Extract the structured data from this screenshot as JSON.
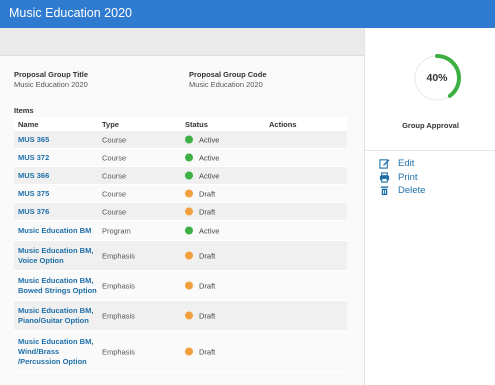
{
  "app": {
    "title": "Music Education 2020"
  },
  "proposal": {
    "group_title_label": "Proposal Group Title",
    "group_title_value": "Music Education 2020",
    "group_code_label": "Proposal Group Code",
    "group_code_value": "Music Education 2020"
  },
  "items": {
    "label": "Items",
    "columns": [
      "Name",
      "Type",
      "Status",
      "Actions"
    ],
    "rows": [
      {
        "name": "MUS 365",
        "type": "Course",
        "status": "Active"
      },
      {
        "name": "MUS 372",
        "type": "Course",
        "status": "Active"
      },
      {
        "name": "MUS 366",
        "type": "Course",
        "status": "Active"
      },
      {
        "name": "MUS 375",
        "type": "Course",
        "status": "Draft"
      },
      {
        "name": "MUS 376",
        "type": "Course",
        "status": "Draft"
      },
      {
        "name": "Music Education BM",
        "type": "Program",
        "status": "Active"
      },
      {
        "name": "Music Education BM, Voice Option",
        "type": "Emphasis",
        "status": "Draft"
      },
      {
        "name": "Music Education BM, Bowed Strings Option",
        "type": "Emphasis",
        "status": "Draft"
      },
      {
        "name": "Music Education BM, Piano/Guitar Option",
        "type": "Emphasis",
        "status": "Draft"
      },
      {
        "name": "Music Education BM, Wind/Brass /Percussion Option",
        "type": "Emphasis",
        "status": "Draft"
      }
    ]
  },
  "approval": {
    "percent_text": "40%",
    "fraction": 0.4,
    "label": "Group Approval"
  },
  "actions": {
    "edit": "Edit",
    "print": "Print",
    "delete": "Delete"
  },
  "colors": {
    "brand": "#2f7bd0",
    "link": "#1e6fa8",
    "active": "#3cb043",
    "draft": "#f2a03d"
  }
}
